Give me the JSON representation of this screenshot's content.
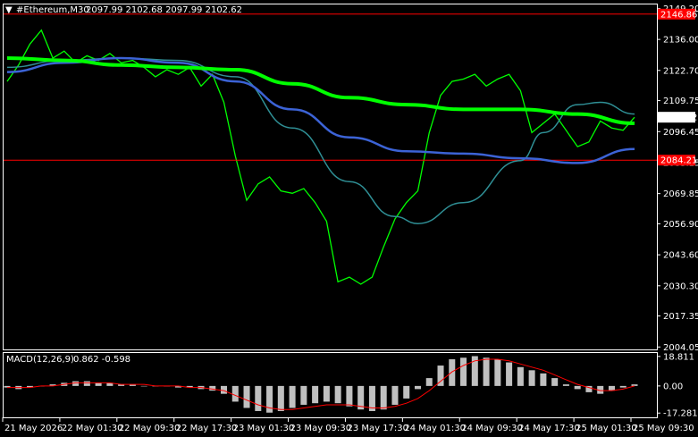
{
  "header": {
    "symbol_timeframe": "#Ethereum,M30",
    "ohlc": "2097.99 2102.68 2097.99 2102.62"
  },
  "macd_header": {
    "label": "MACD(12,26,9)",
    "values": "0.862 -0.598"
  },
  "colors": {
    "background": "#000000",
    "frame": "#ffffff",
    "candles": "#00ff00",
    "ma_fast": "#00ff00",
    "ma_slow": "#3c63d6",
    "ma_mid": "#2f8f95",
    "resistance_line": "#ff0000",
    "macd_histogram": "#c0c0c0",
    "macd_signal": "#ff0000",
    "price_tag": "#ff0000"
  },
  "chart_data": [
    {
      "type": "line",
      "name_hint": "price",
      "y_ticks": [
        "2149.20",
        "2136.00",
        "2122.70",
        "2109.75",
        "2096.45",
        "2083.15",
        "2069.85",
        "2056.90",
        "2043.60",
        "2030.30",
        "2017.35",
        "2004.05"
      ],
      "x_ticks": [
        "21 May 2026",
        "22 May 01:30",
        "22 May 09:30",
        "22 May 17:30",
        "23 May 01:30",
        "23 May 09:30",
        "23 May 17:30",
        "24 May 01:30",
        "24 May 09:30",
        "24 May 17:30",
        "25 May 01:30",
        "25 May 09:30"
      ],
      "ylim": [
        2003,
        2151
      ],
      "current_price": "2102.62",
      "horizontal_levels": [
        "2146.86",
        "2084.21"
      ],
      "close_path": [
        [
          0,
          2118
        ],
        [
          1,
          2125
        ],
        [
          2,
          2134
        ],
        [
          3,
          2140
        ],
        [
          4,
          2128
        ],
        [
          5,
          2131
        ],
        [
          6,
          2126
        ],
        [
          7,
          2129
        ],
        [
          8,
          2127
        ],
        [
          9,
          2130
        ],
        [
          10,
          2126
        ],
        [
          11,
          2127
        ],
        [
          12,
          2124
        ],
        [
          13,
          2120
        ],
        [
          14,
          2123
        ],
        [
          15,
          2121
        ],
        [
          16,
          2124
        ],
        [
          17,
          2116
        ],
        [
          18,
          2121
        ],
        [
          19,
          2109
        ],
        [
          20,
          2086
        ],
        [
          21,
          2067
        ],
        [
          22,
          2074
        ],
        [
          23,
          2077
        ],
        [
          24,
          2071
        ],
        [
          25,
          2070
        ],
        [
          26,
          2072
        ],
        [
          27,
          2066
        ],
        [
          28,
          2058
        ],
        [
          29,
          2032
        ],
        [
          30,
          2034
        ],
        [
          31,
          2031
        ],
        [
          32,
          2034
        ],
        [
          33,
          2047
        ],
        [
          34,
          2059
        ],
        [
          35,
          2066
        ],
        [
          36,
          2071
        ],
        [
          37,
          2096
        ],
        [
          38,
          2112
        ],
        [
          39,
          2118
        ],
        [
          40,
          2119
        ],
        [
          41,
          2121
        ],
        [
          42,
          2116
        ],
        [
          43,
          2119
        ],
        [
          44,
          2121
        ],
        [
          45,
          2114
        ],
        [
          46,
          2096
        ],
        [
          47,
          2100
        ],
        [
          48,
          2104
        ],
        [
          49,
          2097
        ],
        [
          50,
          2090
        ],
        [
          51,
          2092
        ],
        [
          52,
          2101
        ],
        [
          53,
          2098
        ],
        [
          54,
          2097
        ],
        [
          55,
          2102.62
        ]
      ],
      "moving_averages": [
        {
          "color_key": "ma_fast",
          "path": [
            [
              0,
              2128
            ],
            [
              5,
              2127
            ],
            [
              10,
              2125
            ],
            [
              15,
              2124
            ],
            [
              20,
              2123
            ],
            [
              25,
              2117
            ],
            [
              30,
              2111
            ],
            [
              35,
              2108
            ],
            [
              40,
              2106
            ],
            [
              45,
              2106
            ],
            [
              50,
              2104
            ],
            [
              55,
              2100
            ]
          ]
        },
        {
          "color_key": "ma_slow",
          "path": [
            [
              0,
              2122
            ],
            [
              5,
              2126
            ],
            [
              10,
              2128
            ],
            [
              15,
              2126
            ],
            [
              20,
              2118
            ],
            [
              25,
              2106
            ],
            [
              30,
              2094
            ],
            [
              35,
              2088
            ],
            [
              40,
              2087
            ],
            [
              45,
              2085
            ],
            [
              50,
              2083
            ],
            [
              55,
              2089
            ]
          ]
        },
        {
          "color_key": "ma_mid",
          "path": [
            [
              0,
              2124
            ],
            [
              5,
              2127
            ],
            [
              10,
              2128
            ],
            [
              15,
              2127
            ],
            [
              20,
              2120
            ],
            [
              25,
              2098
            ],
            [
              30,
              2075
            ],
            [
              34,
              2060
            ],
            [
              36,
              2057
            ],
            [
              40,
              2066
            ],
            [
              45,
              2084
            ],
            [
              47,
              2096
            ],
            [
              50,
              2108
            ],
            [
              52,
              2109
            ],
            [
              55,
              2104
            ]
          ]
        }
      ]
    },
    {
      "type": "bar",
      "name_hint": "macd",
      "y_ticks": [
        "18.811",
        "0.00",
        "-17.281"
      ],
      "ylim": [
        -20,
        21
      ],
      "histogram": [
        -1,
        -2,
        -1,
        0,
        1,
        2,
        3,
        3,
        2,
        2,
        1,
        1,
        0,
        0,
        0,
        -1,
        -1,
        -2,
        -3,
        -5,
        -10,
        -14,
        -16,
        -17,
        -16,
        -14,
        -12,
        -11,
        -10,
        -11,
        -13,
        -15,
        -16,
        -15,
        -12,
        -8,
        -2,
        5,
        13,
        17,
        18,
        19,
        18,
        17,
        15,
        12,
        10,
        8,
        5,
        1,
        -2,
        -4,
        -5,
        -3,
        -1,
        1
      ],
      "signal": [
        -1,
        -1,
        -1,
        0,
        0,
        1,
        2,
        2,
        2,
        2,
        1,
        1,
        1,
        0,
        0,
        0,
        -1,
        -1,
        -2,
        -3,
        -6,
        -9,
        -12,
        -14,
        -15,
        -15,
        -14,
        -13,
        -12,
        -12,
        -12,
        -13,
        -14,
        -14,
        -13,
        -11,
        -8,
        -3,
        3,
        9,
        13,
        16,
        17,
        17,
        16,
        14,
        12,
        10,
        7,
        4,
        1,
        -1,
        -3,
        -3,
        -2,
        0
      ],
      "current_values": "0.862 -0.598"
    }
  ]
}
